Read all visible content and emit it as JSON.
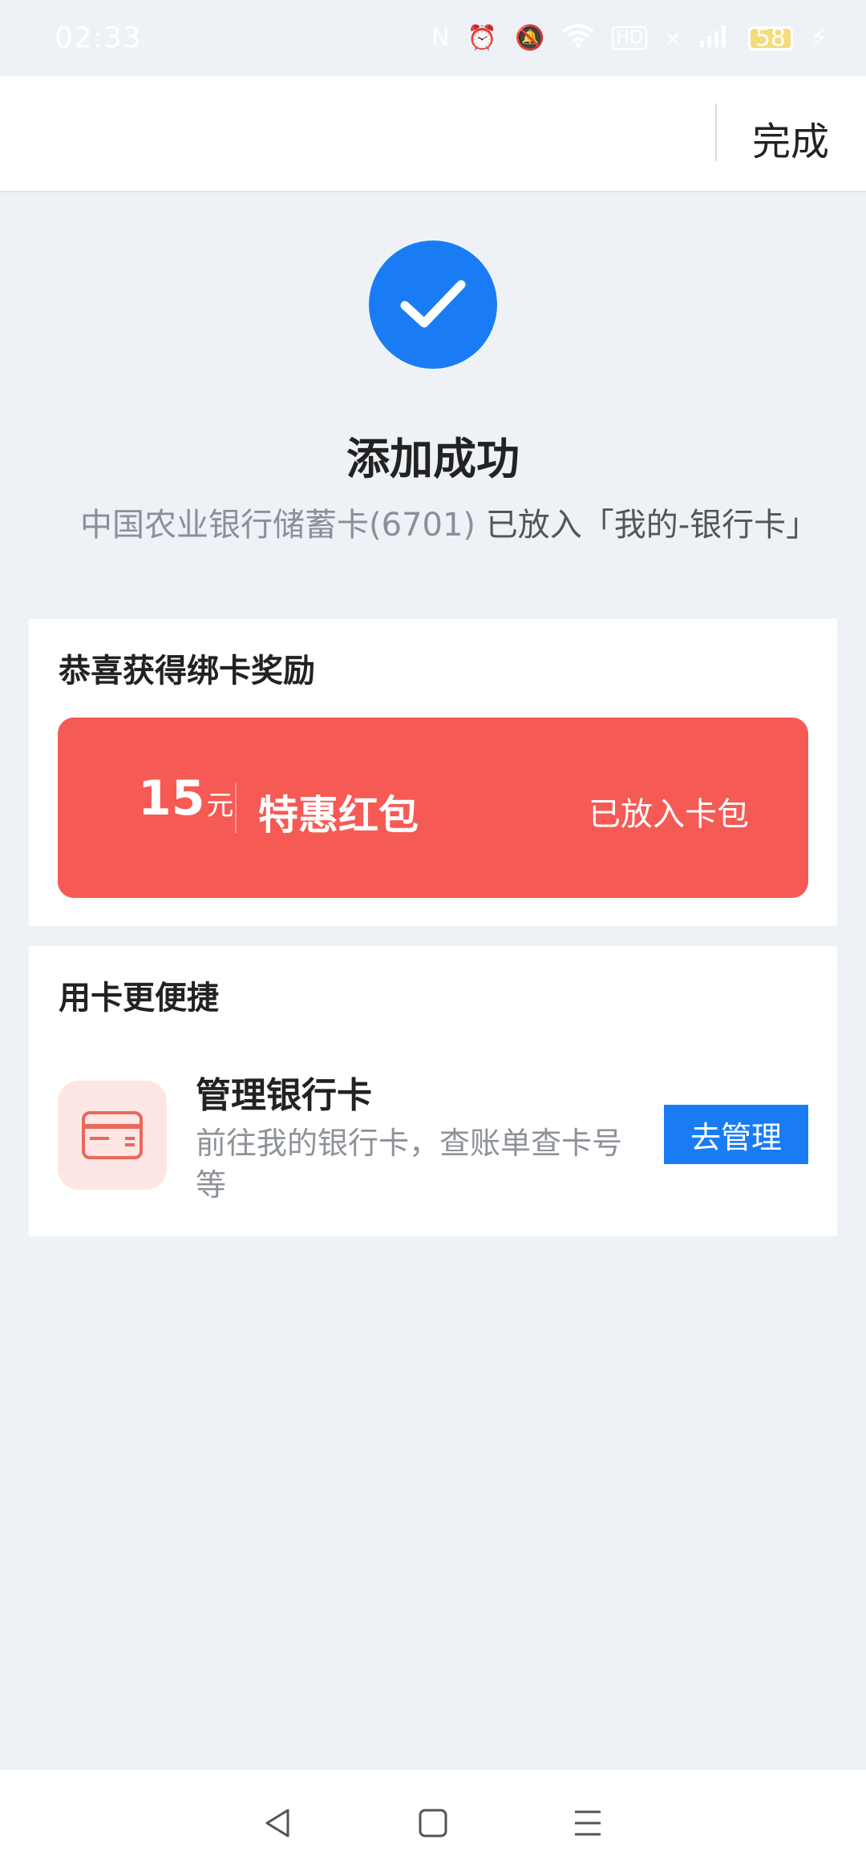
{
  "status_bar": {
    "time": "02:33",
    "icons": [
      "nfc-icon",
      "alarm-icon",
      "silent-icon",
      "wifi-icon",
      "hd-icon",
      "signal-icon",
      "4g-signal-icon",
      "battery-icon",
      "charging-icon"
    ],
    "battery_level": "58"
  },
  "top_bar": {
    "done_label": "完成"
  },
  "result": {
    "title": "添加成功",
    "subtitle_card": "中国农业银行储蓄卡(6701)",
    "subtitle_action": " 已放入「我的-银行卡」",
    "icon": "check-icon",
    "accent_color": "#1a7cf5"
  },
  "reward_section": {
    "title": "恭喜获得绑卡奖励",
    "amount": "15",
    "unit": "元",
    "name": "特惠红包",
    "status": "已放入卡包",
    "color": "#f65a55"
  },
  "manage_section": {
    "title": "用卡更便捷",
    "item_title": "管理银行卡",
    "item_desc": "前往我的银行卡，查账单查卡号等",
    "button_label": "去管理",
    "icon": "bank-card-icon"
  },
  "nav_bar": {
    "buttons": [
      "back-icon",
      "home-icon",
      "menu-icon"
    ]
  }
}
